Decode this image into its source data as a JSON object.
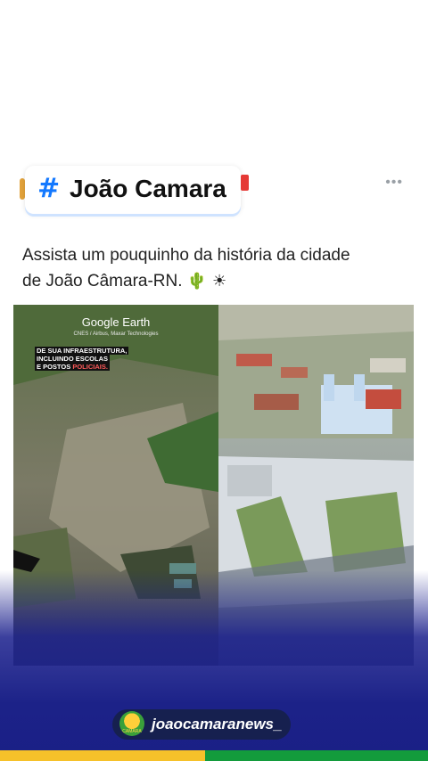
{
  "post": {
    "hashtag_symbol": "#",
    "title": "João Camara",
    "more_menu": "•••",
    "caption_line1": "Assista um pouquinho da história da cidade",
    "caption_line2": "de João Câmara-RN.",
    "caption_emojis": "🌵 ☀",
    "media": {
      "left_panel": {
        "brand": "Google Earth",
        "credit": "CNES / Airbus, Maxar Technologies",
        "overlay_line1": "DE SUA INFRAESTRUTURA,",
        "overlay_line2": "INCLUINDO ESCOLAS",
        "overlay_line3_prefix": "E POSTOS",
        "overlay_line3_highlight": "POLICIAIS."
      }
    }
  },
  "watermark": {
    "logo_text": "CAMARA",
    "handle": "joaocamaranews_"
  },
  "colors": {
    "hash": "#1479ff",
    "bottom_band": "#1c2288",
    "flag_yellow": "#f6c12a",
    "flag_green": "#139b3c"
  }
}
